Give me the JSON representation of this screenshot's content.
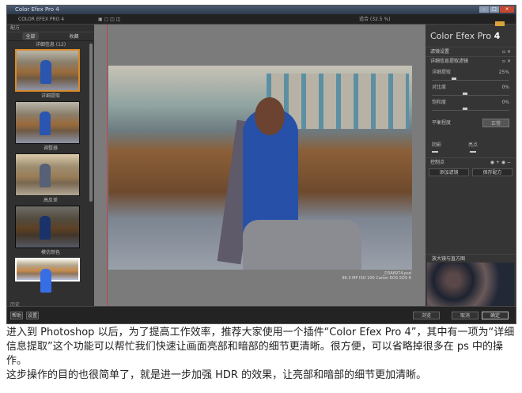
{
  "window": {
    "title": "Color Efex Pro 4",
    "min": "–",
    "max": "□",
    "close": "×"
  },
  "toolbar": {
    "logo": "COLOR EFEX PRO 4",
    "zoom": "适合 (32.5 %)"
  },
  "left_panel": {
    "header": "配方",
    "tabs": [
      "全部",
      "收藏"
    ],
    "group": "详细信息 (12)",
    "presets": [
      "详细提取",
      "调整器",
      "高反差",
      "模仿颜色",
      ""
    ],
    "history": "历史",
    "buttons": [
      "帮助",
      "设置"
    ]
  },
  "photo_info": {
    "filename": "_D3A6974.psd",
    "meta": "96.3 MP  ISO 100  Canon EOS 5DS R"
  },
  "right_panel": {
    "brand": "Color Efex Pro ",
    "brand_num": "4",
    "filters": [
      "滤镜设置",
      "详细信息提取滤镜"
    ],
    "sliders": [
      {
        "label": "详细提取",
        "value": "25%"
      },
      {
        "label": "对比度",
        "value": "0%"
      },
      {
        "label": "饱和度",
        "value": "0%"
      }
    ],
    "dropdown": {
      "label": "平衡程度",
      "value": "正常"
    },
    "shadows_label": "阴影",
    "highlights_label": "亮点",
    "control_points": "控制点",
    "add_filter": "添加滤镜",
    "save_recipe": "保存配方",
    "loupe": "放大镜与直方图"
  },
  "bottom": {
    "browse": "浏览",
    "cancel": "取消",
    "ok": "确定"
  },
  "description": [
    "进入到 Photoshop 以后，为了提高工作效率，推荐大家使用一个插件“Color Efex Pro 4”，其中有一项为“详细信息提取”这个功能可以帮忙我们快速让画面亮部和暗部的细节更清晰。很方便，可以省略掉很多在 ps 中的操作。",
    "这步操作的目的也很简单了，就是进一步加强 HDR 的效果，让亮部和暗部的细节更加清晰。"
  ]
}
